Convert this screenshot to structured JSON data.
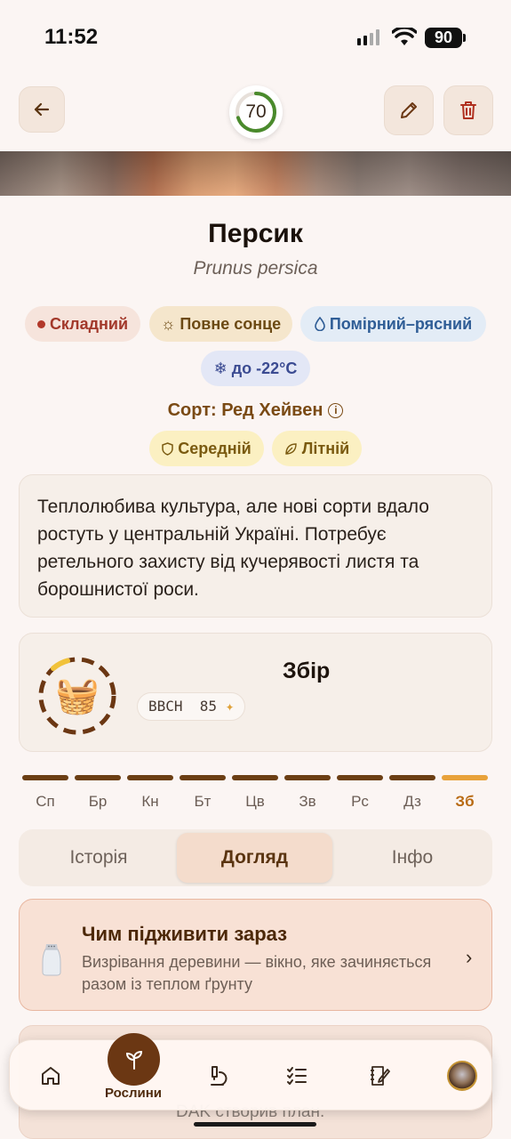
{
  "status_bar": {
    "time": "11:52",
    "battery": "90"
  },
  "header": {
    "score": "70",
    "score_fraction": 0.7,
    "back_icon": "arrow-left-icon",
    "edit_icon": "pencil-icon",
    "delete_icon": "trash-icon"
  },
  "plant": {
    "name": "Персик",
    "latin": "Prunus persica"
  },
  "chips": {
    "difficulty": "Складний",
    "sun": "Повне сонце",
    "water": "Помірний–рясний",
    "frost": "до -22°C"
  },
  "variety": {
    "label": "Сорт: Ред Хейвен",
    "ripening": "Середній",
    "season": "Літній"
  },
  "description": "Теплолюбива культура, але нові сорти вдало ростуть у центральній Україні. Потребує ретельного захисту від кучерявості листя та борошнистої роси.",
  "stage": {
    "title": "Збір",
    "bbch_label": "BBCH",
    "bbch_value": "85",
    "icon": "basket-icon"
  },
  "months": [
    "Сп",
    "Бр",
    "Кн",
    "Бт",
    "Цв",
    "Зв",
    "Рс",
    "Дз",
    "Зб"
  ],
  "current_month_index": 8,
  "colors": {
    "accent": "#6b3713",
    "highlight": "#e8a23a"
  },
  "tabs": [
    "Історія",
    "Догляд",
    "Інфо"
  ],
  "active_tab": "Догляд",
  "feed_card": {
    "title": "Чим підживити зараз",
    "text": "Визрівання деревини — вікно, яке зачиняється разом із теплом ґрунту",
    "icon": "salt-shaker-icon"
  },
  "behind_card": {
    "partial_text": "DAK створив план."
  },
  "bottom_nav": {
    "plants_label": "Рослини"
  }
}
